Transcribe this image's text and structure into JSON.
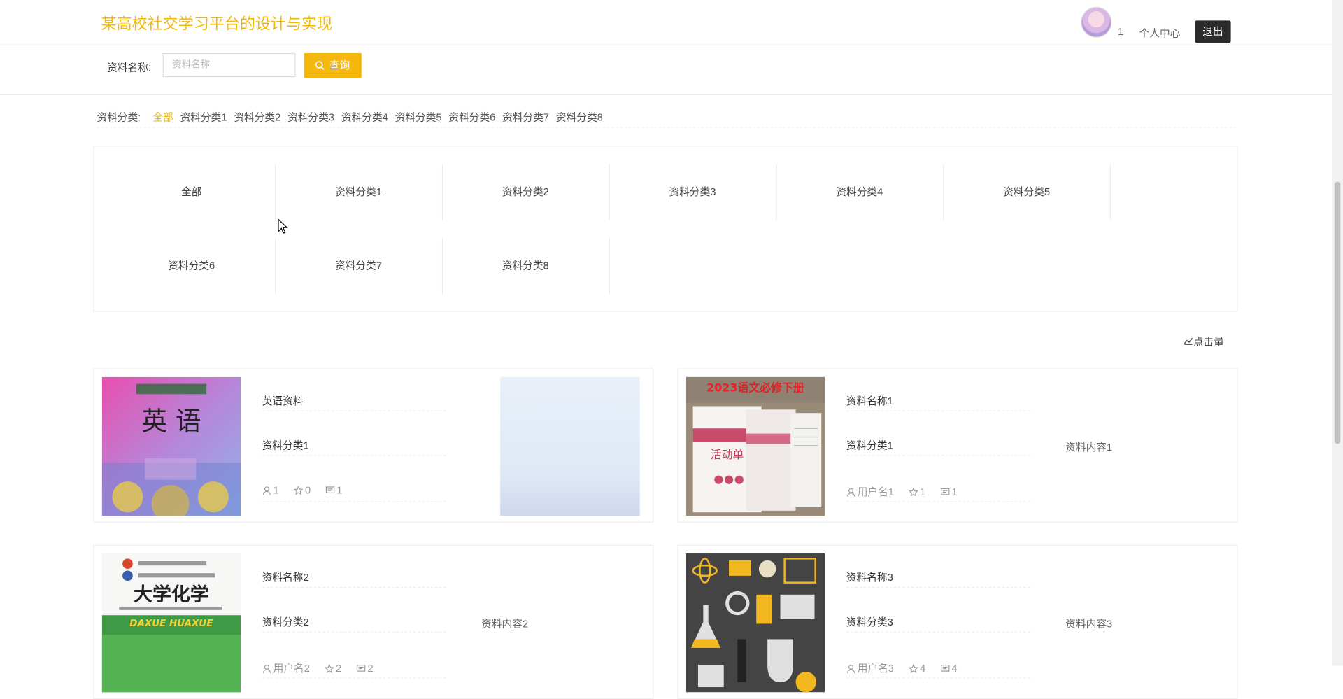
{
  "header": {
    "site_title": "某高校社交学习平台的设计与实现",
    "user_label": "1",
    "user_center": "个人中心",
    "logout": "退出"
  },
  "search": {
    "label": "资料名称:",
    "placeholder": "资料名称",
    "button": "查询"
  },
  "categories": {
    "label": "资料分类:",
    "items": [
      "全部",
      "资料分类1",
      "资料分类2",
      "资料分类3",
      "资料分类4",
      "资料分类5",
      "资料分类6",
      "资料分类7",
      "资料分类8"
    ],
    "active": "全部"
  },
  "sort": {
    "label": "点击量"
  },
  "cards": [
    {
      "name": "英语资料",
      "category": "资料分类1",
      "user": "1",
      "likes": "0",
      "comments": "1",
      "content": "",
      "cover": "english-book-cover"
    },
    {
      "name": "资料名称1",
      "category": "资料分类1",
      "user": "用户名1",
      "likes": "1",
      "comments": "1",
      "content": "资料内容1",
      "cover": "chinese-workbook-cover"
    },
    {
      "name": "资料名称2",
      "category": "资料分类2",
      "user": "用户名2",
      "likes": "2",
      "comments": "2",
      "content": "资料内容2",
      "cover": "chemistry-book-cover"
    },
    {
      "name": "资料名称3",
      "category": "资料分类3",
      "user": "用户名3",
      "likes": "4",
      "comments": "4",
      "content": "资料内容3",
      "cover": "science-icons-cover"
    }
  ],
  "colors": {
    "brand": "#f0b90b",
    "button": "#f5b80d",
    "logout_bg": "#2b2b2b"
  }
}
